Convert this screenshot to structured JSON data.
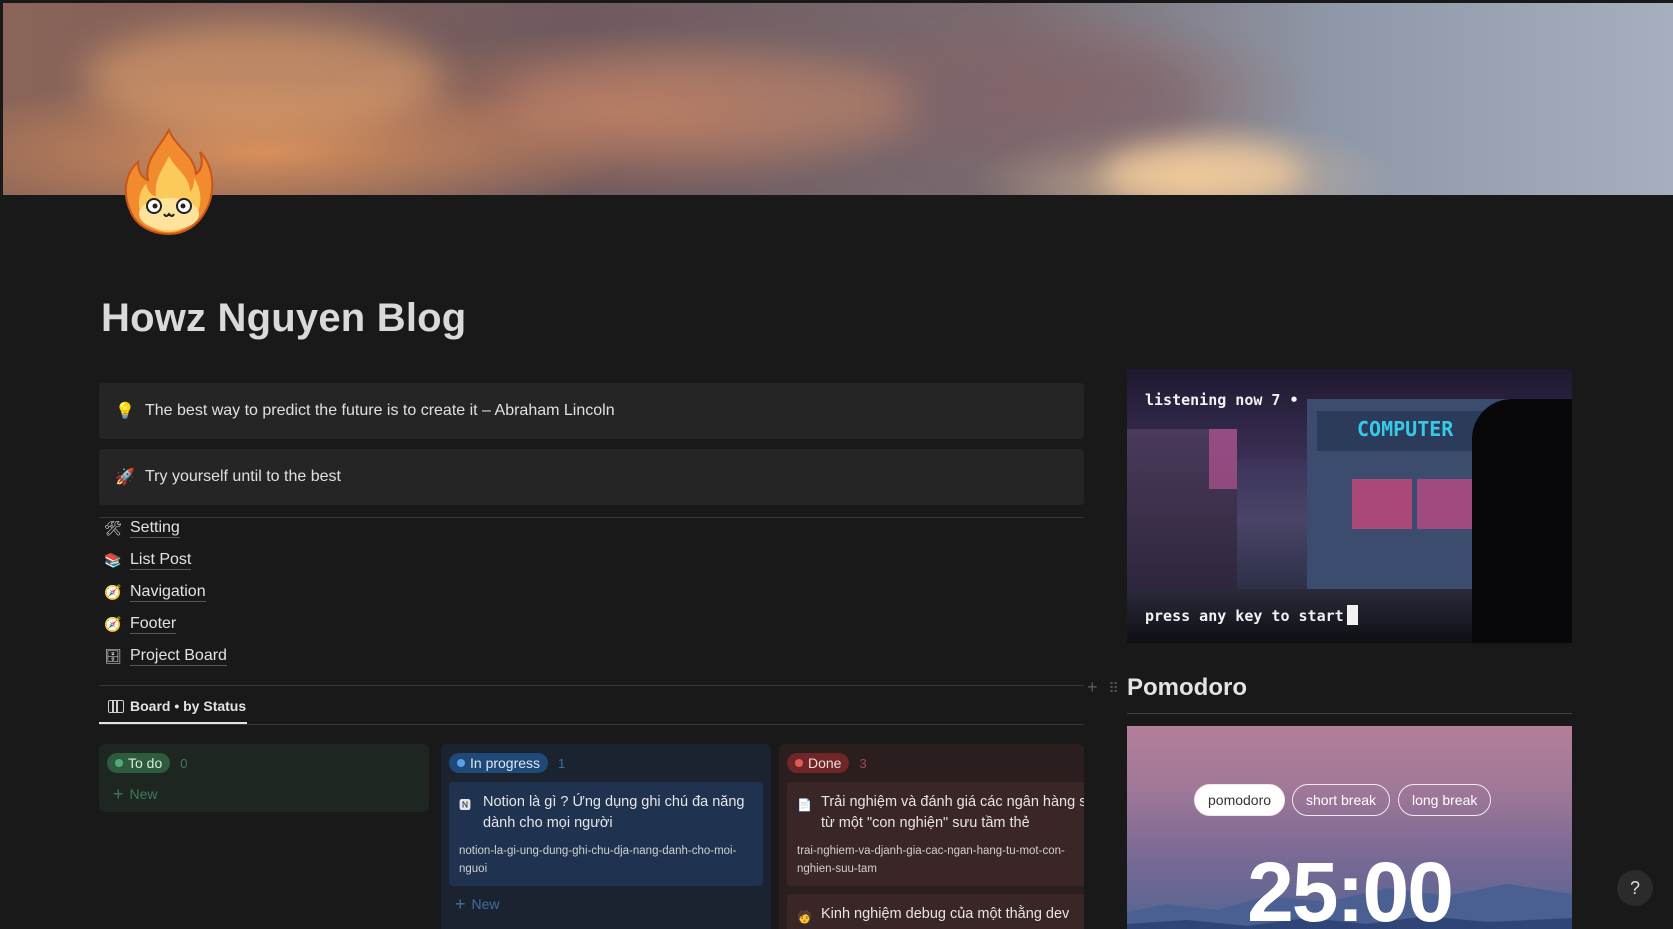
{
  "page": {
    "title": "Howz Nguyen Blog",
    "icon": "flame-face-icon"
  },
  "callouts": [
    {
      "icon": "lightbulb-icon",
      "text": "The best way to predict the future is to create it – Abraham Lincoln"
    },
    {
      "icon": "rocket-icon",
      "text": "Try yourself until to the best"
    }
  ],
  "links": [
    {
      "icon": "tools-icon",
      "label": "Setting"
    },
    {
      "icon": "books-icon",
      "label": "List Post"
    },
    {
      "icon": "compass-icon",
      "label": "Navigation"
    },
    {
      "icon": "compass-icon",
      "label": "Footer"
    },
    {
      "icon": "file-cabinet-icon",
      "label": "Project Board"
    }
  ],
  "board": {
    "view_label": "Board • by Status",
    "new_label": "New",
    "columns": [
      {
        "status": "To do",
        "count": "0",
        "color": "#2e7d4f",
        "dot": "#4caf77",
        "bg": "#1e2621",
        "text": "#d5eedd",
        "muted": "#3f7a57",
        "cards": []
      },
      {
        "status": "In progress",
        "count": "1",
        "color": "#1f5a94",
        "dot": "#5aa0e6",
        "bg": "#1c2330",
        "text": "#dbe8f7",
        "muted": "#3d6fa3",
        "cards": [
          {
            "title": "Notion là gì ? Ứng dụng ghi chú đa năng dành cho mọi người",
            "slug": "notion-la-gi-ung-dung-ghi-chu-dja-nang-danh-cho-moi-nguoi"
          }
        ]
      },
      {
        "status": "Done",
        "count": "3",
        "color": "#8b2a2a",
        "dot": "#e05a5a",
        "bg": "#2b1e1e",
        "text": "#f5dada",
        "muted": "#a34a4a",
        "cards": [
          {
            "title": "Trải nghiệm và đánh giá các ngân hàng số từ một \"con nghiện\" sưu tầm thẻ",
            "slug": "trai-nghiem-va-djanh-gia-cac-ngan-hang-tu-mot-con-nghien-suu-tam"
          },
          {
            "title": "Kinh nghiệm debug của một thằng dev",
            "slug": ""
          }
        ]
      }
    ]
  },
  "gif": {
    "top_text": "listening now 7 •",
    "bottom_text": "press any key to start",
    "sign": "COMPUTER"
  },
  "pomodoro": {
    "heading": "Pomodoro",
    "modes": [
      "pomodoro",
      "short break",
      "long break"
    ],
    "active_mode": "pomodoro",
    "timer": "25:00"
  },
  "help_label": "?"
}
